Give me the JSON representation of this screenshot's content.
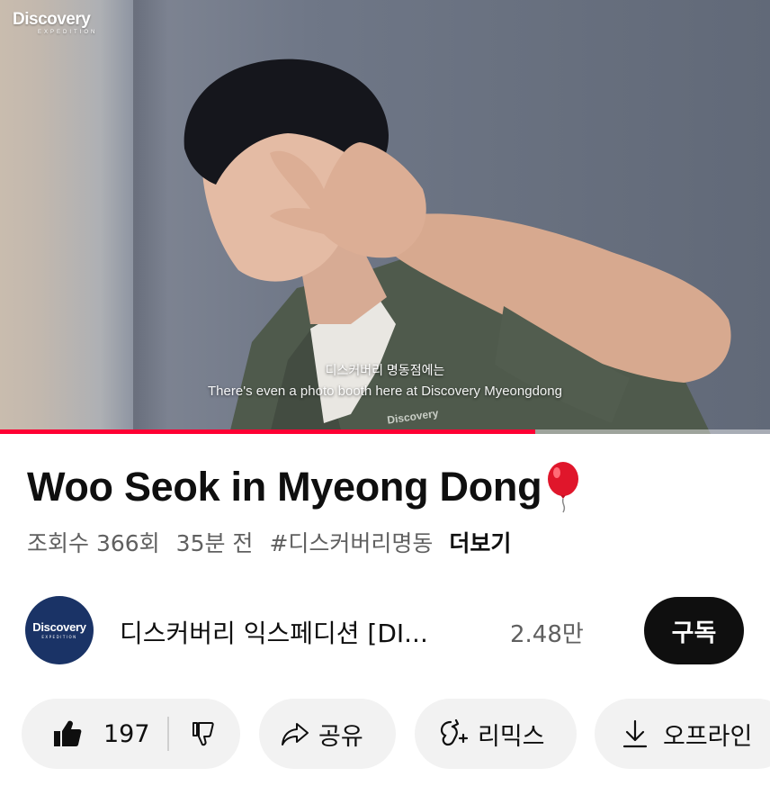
{
  "player": {
    "watermark": "Discovery",
    "watermark_sub": "EXPEDITION",
    "caption_korean": "디스커버리 명동점에는",
    "caption_english": "There's even a photo booth here at Discovery Myeongdong",
    "progress_percent": 69.5
  },
  "video": {
    "title": "Woo Seok in Myeong Dong",
    "title_emoji_icon": "balloon-icon",
    "views": "조회수 366회",
    "time_ago": "35분 전",
    "hashtag": "#디스커버리명동",
    "more_label": "더보기"
  },
  "channel": {
    "avatar_text": "Discovery",
    "avatar_subtext": "EXPEDITION",
    "name": "디스커버리 익스페디션 [DI...",
    "subscribers": "2.48만",
    "subscribe_label": "구독"
  },
  "actions": {
    "like_count": "197",
    "share_label": "공유",
    "remix_label": "리믹스",
    "offline_label": "오프라인"
  },
  "colors": {
    "progress": "#ff0033",
    "text_primary": "#0f0f0f",
    "text_secondary": "#606060",
    "pill_bg": "#f2f2f2",
    "avatar_bg": "#1a3366"
  }
}
